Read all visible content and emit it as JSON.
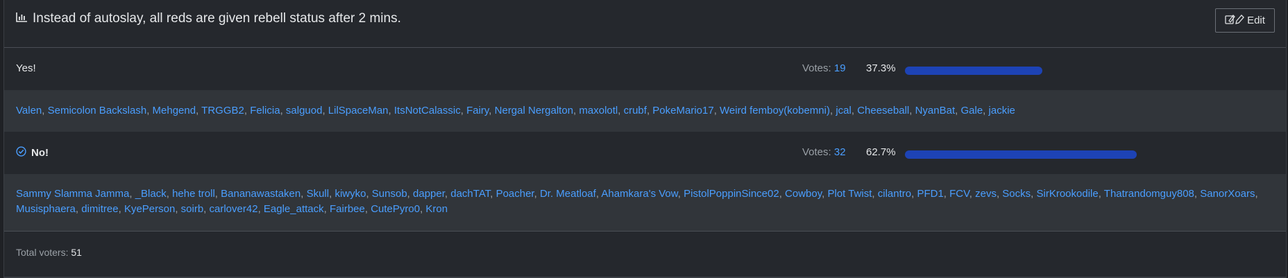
{
  "poll": {
    "title": "Instead of autoslay, all reds are given rebell status after 2 mins.",
    "edit_label": "Edit",
    "votes_label": "Votes: ",
    "options": [
      {
        "label": "Yes!",
        "votes": "19",
        "percent_text": "37.3%",
        "fraction": 0.373,
        "selected": false,
        "voters": [
          "Valen",
          "Semicolon Backslash",
          "Mehgend",
          "TRGGB2",
          "Felicia",
          "salguod",
          "LilSpaceMan",
          "ItsNotCalassic",
          "Fairy",
          "Nergal Nergalton",
          "maxolotl",
          "crubf",
          "PokeMario17",
          "Weird femboy(kobemni)",
          "jcal",
          "Cheeseball",
          "NyanBat",
          "Gale",
          "jackie"
        ]
      },
      {
        "label": "No!",
        "votes": "32",
        "percent_text": "62.7%",
        "fraction": 0.627,
        "selected": true,
        "voters": [
          "Sammy Slamma Jamma",
          "_Black",
          "hehe troll",
          "Bananawastaken",
          "Skull",
          "kiwyko",
          "Sunsob",
          "dapper",
          "dachTAT",
          "Poacher",
          "Dr. Meatloaf",
          "Ahamkara's Vow",
          "PistolPoppinSince02",
          "Cowboy",
          "Plot Twist",
          "cilantro",
          "PFD1",
          "FCV",
          "zevs",
          "Socks",
          "SirKrookodile",
          "Thatrandomguy808",
          "SanorXoars",
          "Musisphaera",
          "dimitree",
          "KyePerson",
          "soirb",
          "carlover42",
          "Eagle_attack",
          "Fairbee",
          "CutePyro0",
          "Kron"
        ]
      }
    ],
    "total_label": "Total voters: ",
    "total_value": "51",
    "colors": {
      "accent": "#4a9eff",
      "bar": "#1d43b5",
      "background": "#25282d",
      "voter_bg": "#31353a"
    },
    "icons": {
      "title": "bar-chart-icon",
      "edit": "edit-pencil-icon",
      "selected": "check-circle-icon"
    }
  }
}
